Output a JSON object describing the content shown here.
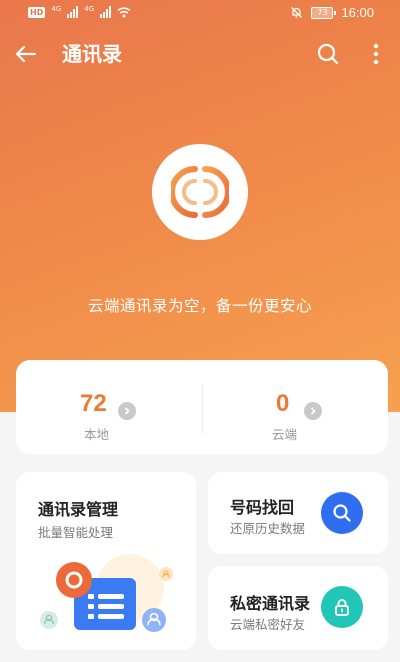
{
  "status_bar": {
    "network_badge": "HD",
    "signal_1": "4G",
    "signal_2": "4G",
    "battery": "73",
    "time": "16:00"
  },
  "header": {
    "title": "通讯录"
  },
  "hero": {
    "message": "云端通讯录为空，备一份更安心"
  },
  "stats": {
    "local": {
      "count": "72",
      "label": "本地"
    },
    "cloud": {
      "count": "0",
      "label": "云端"
    }
  },
  "cards": {
    "management": {
      "title": "通讯录管理",
      "subtitle": "批量智能处理"
    },
    "recover": {
      "title": "号码找回",
      "subtitle": "还原历史数据"
    },
    "private": {
      "title": "私密通讯录",
      "subtitle": "云端私密好友"
    }
  },
  "colors": {
    "accent": "#ec7a35",
    "search_blue": "#2f6ef0",
    "lock_teal": "#20c6b6"
  }
}
